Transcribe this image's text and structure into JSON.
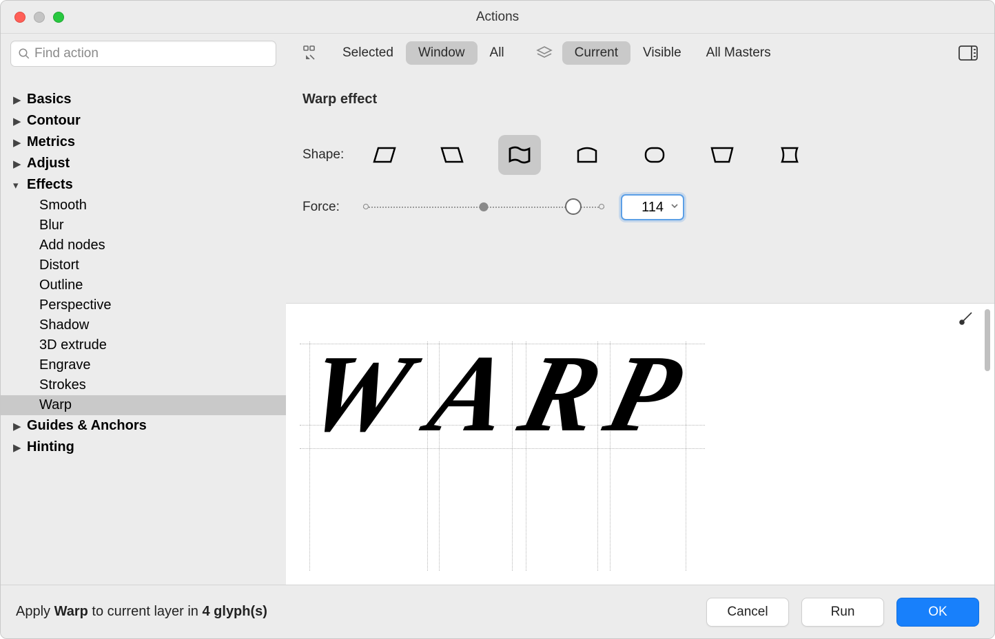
{
  "window_title": "Actions",
  "search": {
    "placeholder": "Find action"
  },
  "categories": [
    {
      "name": "Basics",
      "expanded": false,
      "children": []
    },
    {
      "name": "Contour",
      "expanded": false,
      "children": []
    },
    {
      "name": "Metrics",
      "expanded": false,
      "children": []
    },
    {
      "name": "Adjust",
      "expanded": false,
      "children": []
    },
    {
      "name": "Effects",
      "expanded": true,
      "children": [
        "Smooth",
        "Blur",
        "Add nodes",
        "Distort",
        "Outline",
        "Perspective",
        "Shadow",
        "3D extrude",
        "Engrave",
        "Strokes",
        "Warp"
      ]
    },
    {
      "name": "Guides & Anchors",
      "expanded": false,
      "children": []
    },
    {
      "name": "Hinting",
      "expanded": false,
      "children": []
    }
  ],
  "selected_action": "Warp",
  "toolbar": {
    "scope": [
      "Selected",
      "Window",
      "All"
    ],
    "scope_active": 1,
    "layers": [
      "Current",
      "Visible",
      "All Masters"
    ],
    "layers_active": 0
  },
  "panel": {
    "title": "Warp effect",
    "shape_label": "Shape:",
    "shape_count": 7,
    "shape_active": 2,
    "force_label": "Force:",
    "force_value": "114",
    "slider_mid_pct": 50,
    "slider_main_pct": 87
  },
  "preview": {
    "glyphs": [
      "W",
      "A",
      "R",
      "P"
    ]
  },
  "footer": {
    "status_prefix": "Apply ",
    "status_action": "Warp",
    "status_mid": " to current layer in ",
    "status_count": "4 glyph(s)",
    "cancel": "Cancel",
    "run": "Run",
    "ok": "OK"
  }
}
